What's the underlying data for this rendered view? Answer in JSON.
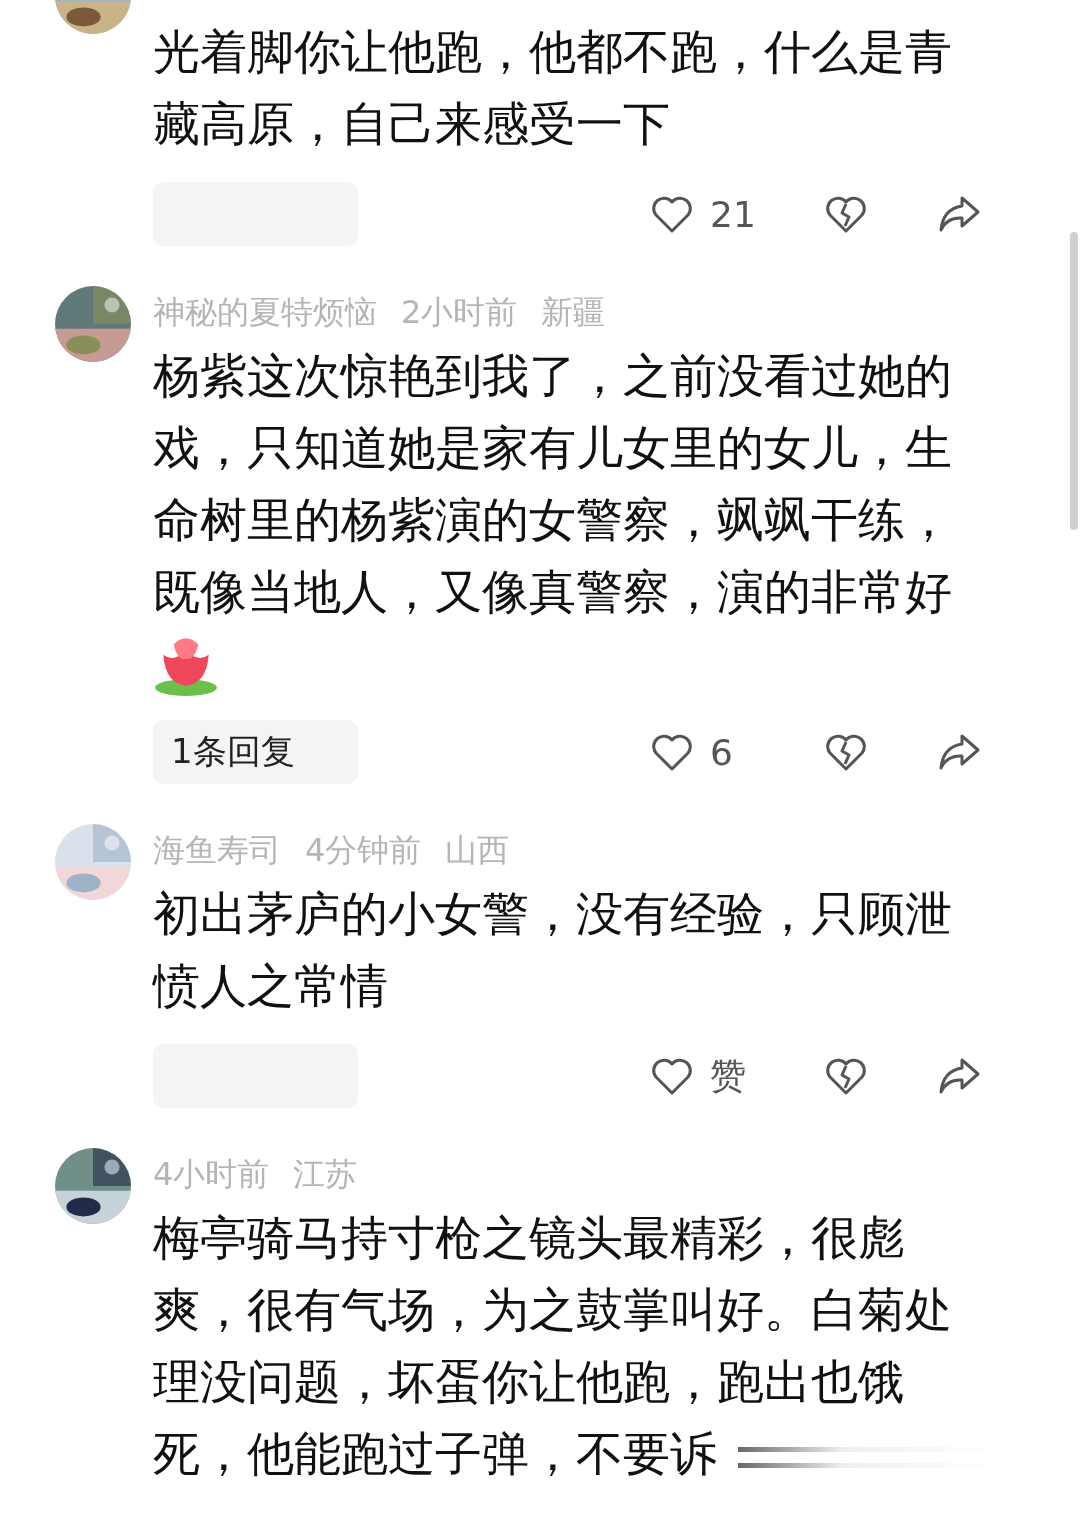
{
  "comments": [
    {
      "text": "光着脚你让他跑，他都不跑，什么是青藏高原，自己来感受一下",
      "has_reply": true,
      "likes": "21"
    },
    {
      "meta": {
        "name": "神秘的夏特烦恼",
        "time": "2小时前",
        "location": "新疆"
      },
      "text": "杨紫这次惊艳到我了，之前没看过她的戏，只知道她是家有儿女里的女儿，生命树里的杨紫演的女警察，飒飒干练，既像当地人，又像真警察，演的非常好",
      "emoji": true,
      "has_reply": true,
      "reply_label": "1条回复",
      "likes": "6"
    },
    {
      "meta": {
        "name": "海鱼寿司",
        "time": "4分钟前",
        "location": "山西"
      },
      "text": "初出茅庐的小女警，没有经验，只顾泄愤人之常情",
      "has_reply": true,
      "likes": "赞"
    },
    {
      "meta": {
        "time": "4小时前",
        "location": "江苏"
      },
      "text": "梅亭骑马持寸枪之镜头最精彩，很彪爽，很有气场，为之鼓掌叫好。白菊处理没问题，坏蛋你让他跑，跑出也饿死，他能跑过子弹，不要诉",
      "faded": true
    }
  ]
}
